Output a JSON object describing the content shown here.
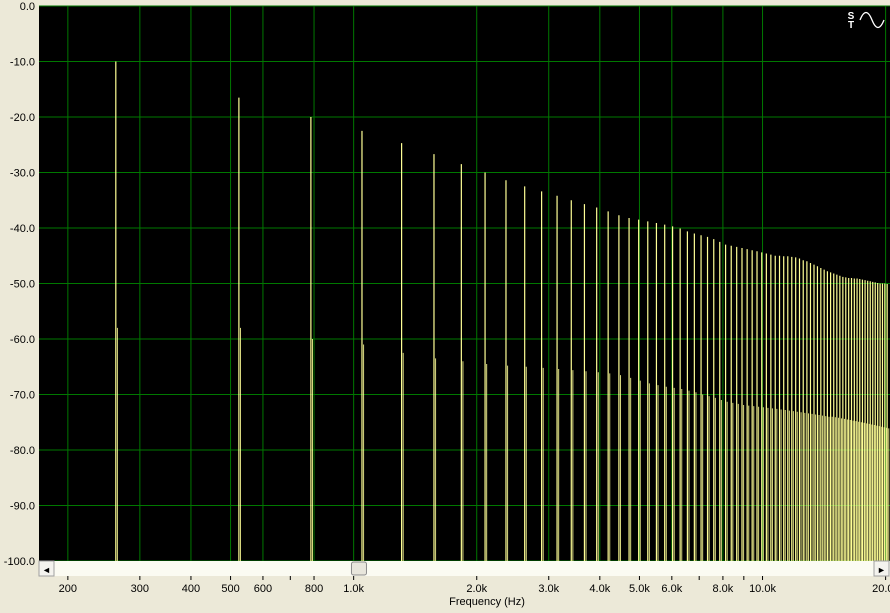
{
  "chart_data": {
    "type": "bar",
    "title": "",
    "xlabel": "Frequency (Hz)",
    "ylabel": "",
    "x_scale": "log",
    "xlim": [
      170,
      20500
    ],
    "ylim": [
      -100,
      0
    ],
    "grid": true,
    "y_ticks": [
      0,
      -10,
      -20,
      -30,
      -40,
      -50,
      -60,
      -70,
      -80,
      -90,
      -100
    ],
    "y_tick_labels": [
      "0.0",
      "-10.0",
      "-20.0",
      "-30.0",
      "-40.0",
      "-50.0",
      "-60.0",
      "-70.0",
      "-80.0",
      "-90.0",
      "-100.0"
    ],
    "x_ticks": [
      200,
      300,
      400,
      500,
      600,
      800,
      1000,
      2000,
      3000,
      4000,
      5000,
      6000,
      8000,
      10000,
      20000
    ],
    "x_tick_labels": [
      "200",
      "300",
      "400",
      "500",
      "600",
      "800",
      "1.0k",
      "2.0k",
      "3.0k",
      "4.0k",
      "5.0k",
      "6.0k",
      "8.0k",
      "10.0k",
      "20.0k"
    ],
    "x_minor_ticks": [
      700,
      7000,
      9000
    ],
    "fundamental_hz": 262,
    "series": [
      {
        "name": "",
        "color": "#ffff96",
        "harmonic_peak_db": [
          -10,
          -16.5,
          -20,
          -22.5,
          -24.7,
          -26.7,
          -28.5,
          -30,
          -31.4,
          -32.5,
          -33.4,
          -34.2,
          -35,
          -35.7,
          -36.3,
          -37,
          -37.7,
          -38.2,
          -38.5,
          -38.8,
          -39.1,
          -39.4,
          -39.7,
          -40.1,
          -40.6,
          -41,
          -41.3,
          -41.6,
          -42,
          -42.5,
          -43,
          -43.2,
          -43.4,
          -43.6,
          -43.8,
          -44,
          -44.2,
          -44.4,
          -44.6,
          -44.8,
          -45,
          -45,
          -45.1,
          -45.1,
          -45.2,
          -45.3,
          -45.5,
          -45.8,
          -46,
          -46.3,
          -46.6,
          -46.9,
          -47.2,
          -47.5,
          -47.8,
          -48,
          -48.2,
          -48.4,
          -48.6,
          -48.8,
          -48.9,
          -49,
          -49,
          -49.1,
          -49.1,
          -49.2,
          -49.3,
          -49.4,
          -49.5,
          -49.6,
          -49.7,
          -49.8,
          -49.9,
          -50,
          -50,
          -50,
          -50.1
        ],
        "secondary_level_db": [
          -58,
          -58,
          -60,
          -61,
          -62.5,
          -63.5,
          -64,
          -64.5,
          -64.8,
          -65,
          -65.2,
          -65.4,
          -65.6,
          -65.8,
          -66,
          -66.2,
          -66.5,
          -67,
          -67.5,
          -68,
          -68.3,
          -68.6,
          -68.8,
          -69,
          -69.3,
          -69.6,
          -70,
          -70.3,
          -70.6,
          -71,
          -71.3,
          -71.5,
          -71.7,
          -71.9,
          -72,
          -72.1,
          -72.2,
          -72.3,
          -72.4,
          -72.5,
          -72.6,
          -72.7,
          -72.8,
          -72.9,
          -73,
          -73.1,
          -73.2,
          -73.3,
          -73.4,
          -73.5,
          -73.6,
          -73.7,
          -73.8,
          -73.9,
          -74,
          -74,
          -74.1,
          -74.2,
          -74.3,
          -74.4,
          -74.5,
          -74.6,
          -74.7,
          -74.8,
          -74.9,
          -75,
          -75.1,
          -75.2,
          -75.3,
          -75.4,
          -75.5,
          -75.6,
          -75.7,
          -75.8,
          -75.9,
          -76,
          -76.1
        ]
      }
    ]
  },
  "toolbar_icon": "stereo-sine-wave-icon",
  "scrollbar": {
    "left_arrow": "◄",
    "right_arrow": "►",
    "thumb_position": 0.37
  },
  "colors": {
    "plot_background": "#000000",
    "grid": "#007800",
    "trace": "#ffff96",
    "frame": "#ece9d8",
    "text": "#000000"
  }
}
